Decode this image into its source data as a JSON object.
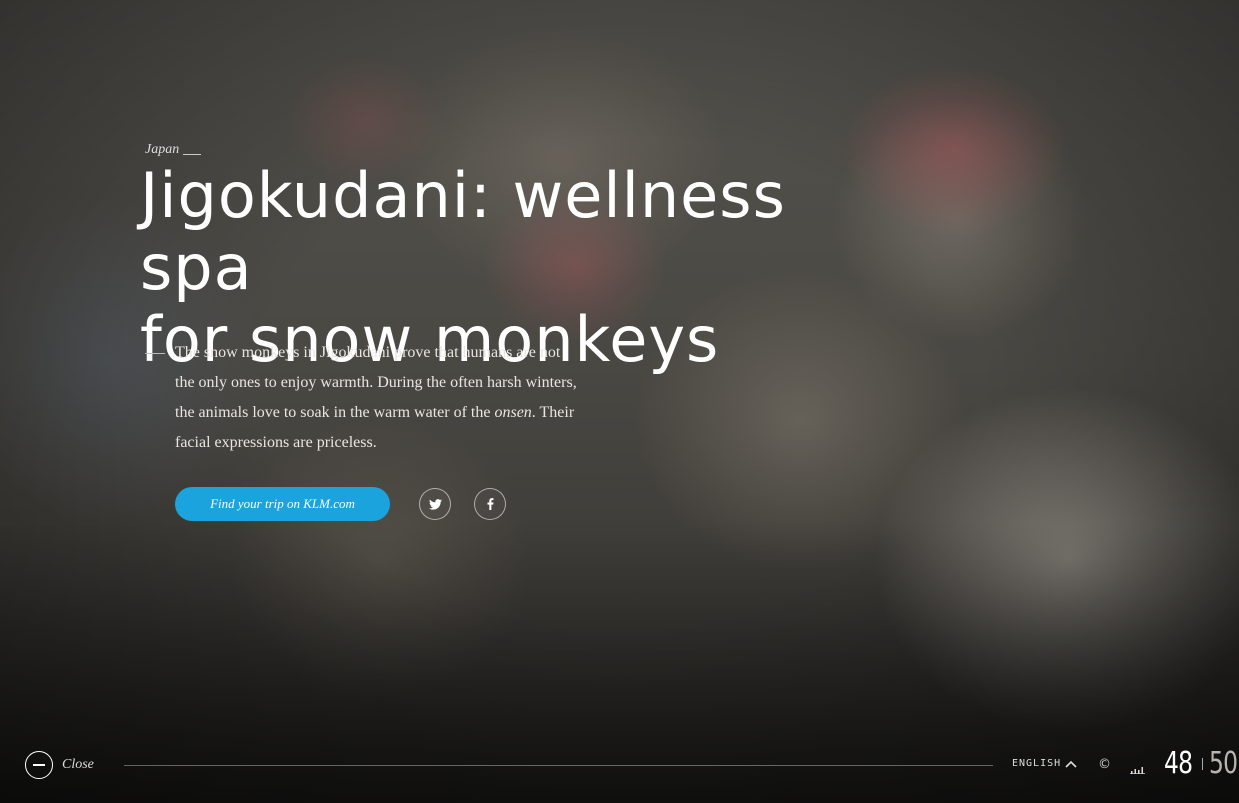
{
  "article": {
    "country": "Japan",
    "title_line1": "Jigokudani: wellness spa",
    "title_line2": "for snow monkeys",
    "intro_part1": "The snow monkeys in Jigokudani prove that humans are not the only ones to enjoy warmth. During the often harsh winters, the animals love to soak in the warm water of the ",
    "intro_emphasis": "onsen",
    "intro_part2": ". Their facial expressions are priceless.",
    "cta_label": "Find your trip on KLM.com"
  },
  "share": {
    "twitter_icon": "twitter-icon",
    "facebook_icon": "facebook-icon"
  },
  "footer": {
    "close_label": "Close",
    "language": "ENGLISH",
    "copyright_symbol": "©",
    "page_current": "48",
    "page_total": "50"
  },
  "colors": {
    "accent": "#1aa3dc"
  }
}
